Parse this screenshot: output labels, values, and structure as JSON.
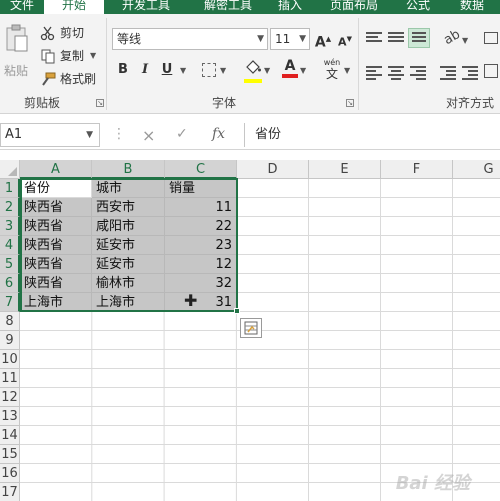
{
  "ribbon": {
    "tabs": [
      "文件",
      "开始",
      "开发工具",
      "解密工具",
      "插入",
      "页面布局",
      "公式",
      "数据"
    ],
    "active_tab": "开始",
    "clipboard": {
      "paste_label": "粘贴",
      "cut_label": "剪切",
      "copy_label": "复制",
      "format_painter_label": "格式刷",
      "group_label": "剪贴板"
    },
    "font": {
      "font_name": "等线",
      "font_size": "11",
      "bold": "B",
      "italic": "I",
      "underline": "U",
      "phonetic": "wén",
      "phonetic_char": "文",
      "group_label": "字体"
    },
    "alignment": {
      "group_label": "对齐方式"
    }
  },
  "formula_bar": {
    "name_box": "A1",
    "cancel_icon": "×",
    "enter_icon": "✓",
    "fx_label": "fx",
    "value": "省份"
  },
  "sheet": {
    "columns": [
      "A",
      "B",
      "C",
      "D",
      "E",
      "F",
      "G"
    ],
    "rows": [
      "1",
      "2",
      "3",
      "4",
      "5",
      "6",
      "7",
      "8",
      "9",
      "10",
      "11",
      "12",
      "13",
      "14",
      "15",
      "16",
      "17"
    ],
    "data": [
      [
        "省份",
        "城市",
        "销量"
      ],
      [
        "陕西省",
        "西安市",
        "11"
      ],
      [
        "陕西省",
        "咸阳市",
        "22"
      ],
      [
        "陕西省",
        "延安市",
        "23"
      ],
      [
        "陕西省",
        "延安市",
        "12"
      ],
      [
        "陕西省",
        "榆林市",
        "32"
      ],
      [
        "上海市",
        "上海市",
        "31"
      ]
    ]
  },
  "colors": {
    "accent": "#217346",
    "selection_fill": "#c6c6c6"
  },
  "watermark": "Bai 经验"
}
